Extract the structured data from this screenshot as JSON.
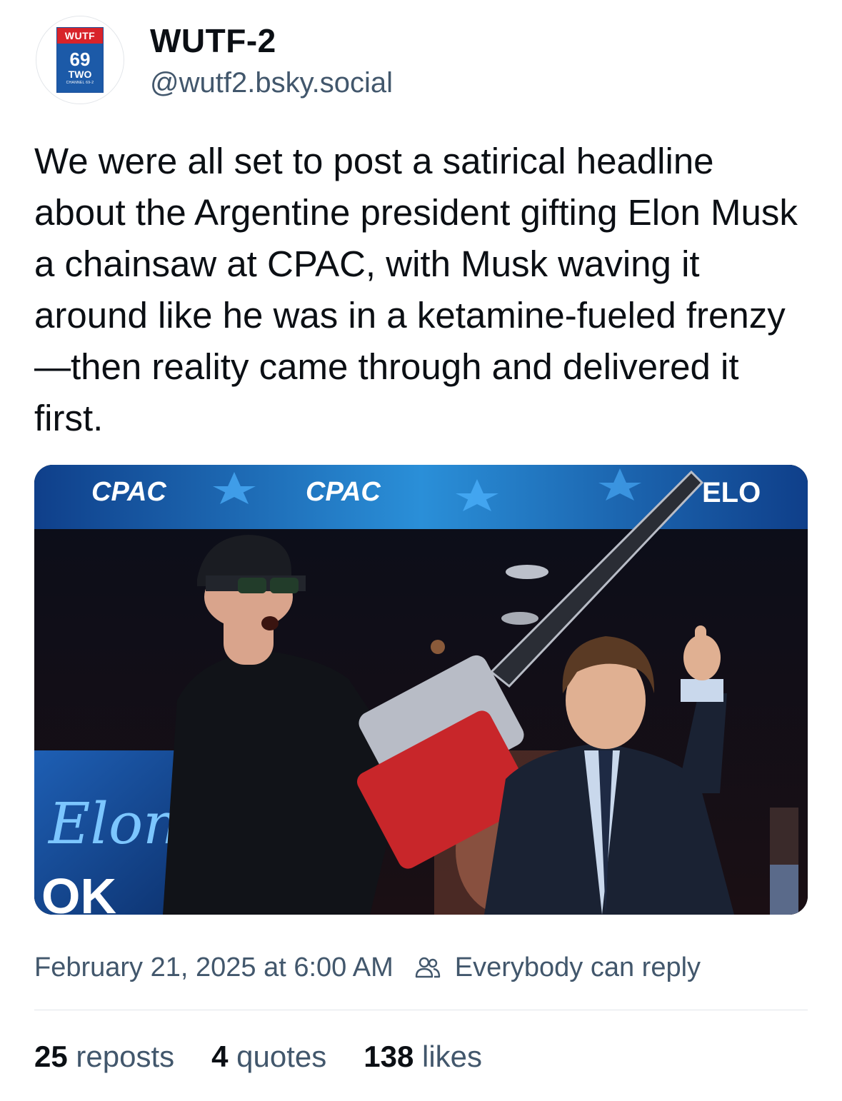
{
  "author": {
    "display_name": "WUTF-2",
    "handle": "@wutf2.bsky.social",
    "avatar_logo": {
      "top": "WUTF",
      "number": "69",
      "word": "TWO",
      "channel": "CHANNEL 69-2"
    }
  },
  "post": {
    "text": "We were all set to post a satirical headline about the Argentine president gifting Elon Musk a chainsaw at CPAC, with Musk waving it around like he was in a ketamine-fueled frenzy—then reality came through and delivered it first."
  },
  "media": {
    "banner_text_1": "CPAC",
    "banner_text_2": "CPAC",
    "banner_text_3": "ELO",
    "screen_signature": "Elon",
    "screen_fragment": "OK"
  },
  "meta": {
    "timestamp": "February 21, 2025 at 6:00 AM",
    "reply_setting": "Everybody can reply",
    "reply_icon": "people-icon"
  },
  "stats": {
    "reposts_count": "25",
    "reposts_label": "reposts",
    "quotes_count": "4",
    "quotes_label": "quotes",
    "likes_count": "138",
    "likes_label": "likes"
  },
  "colors": {
    "text": "#0b0f14",
    "muted": "#42576c",
    "logo_red": "#d8232a",
    "logo_blue": "#1c5aa8"
  }
}
